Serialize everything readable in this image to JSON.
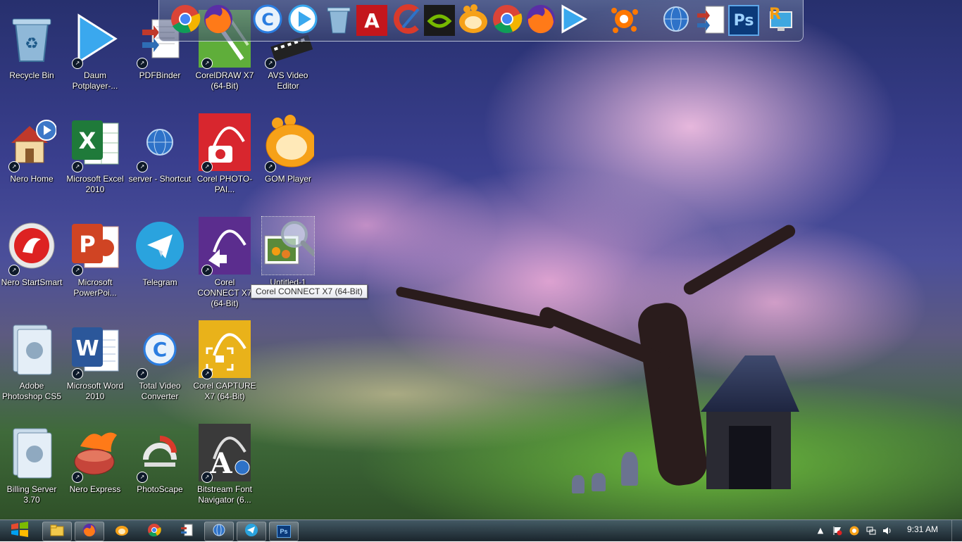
{
  "desktop": {
    "icons": [
      {
        "label": "Recycle Bin",
        "icon": "recycle-bin-icon"
      },
      {
        "label": "Daum Potplayer-...",
        "icon": "potplayer-icon"
      },
      {
        "label": "PDFBinder",
        "icon": "pdfbinder-icon"
      },
      {
        "label": "CorelDRAW X7 (64-Bit)",
        "icon": "coreldraw-icon"
      },
      {
        "label": "AVS Video Editor",
        "icon": "avs-video-editor-icon"
      },
      {
        "label": "Nero Home",
        "icon": "nero-home-icon"
      },
      {
        "label": "Microsoft Excel 2010",
        "icon": "excel-icon"
      },
      {
        "label": "server - Shortcut",
        "icon": "server-globe-icon"
      },
      {
        "label": "Corel PHOTO-PAI...",
        "icon": "corel-photo-paint-icon"
      },
      {
        "label": "GOM Player",
        "icon": "gom-player-icon"
      },
      {
        "label": "Nero StartSmart",
        "icon": "nero-startsmart-icon"
      },
      {
        "label": "Microsoft PowerPoi...",
        "icon": "powerpoint-icon"
      },
      {
        "label": "Telegram",
        "icon": "telegram-icon"
      },
      {
        "label": "Corel CONNECT X7 (64-Bit)",
        "icon": "corel-connect-icon"
      },
      {
        "label": "Untitled-1",
        "icon": "image-search-icon"
      },
      {
        "label": "Adobe Photoshop CS5",
        "icon": "photoshop-folder-icon"
      },
      {
        "label": "Microsoft Word 2010",
        "icon": "word-icon"
      },
      {
        "label": "Total Video Converter",
        "icon": "total-video-converter-icon"
      },
      {
        "label": "Corel CAPTURE X7 (64-Bit)",
        "icon": "corel-capture-icon"
      },
      {
        "label": "Billing Server 3.70",
        "icon": "billing-server-icon"
      },
      {
        "label": "Nero Express",
        "icon": "nero-express-icon"
      },
      {
        "label": "PhotoScape",
        "icon": "photoscape-icon"
      },
      {
        "label": "Bitstream Font Navigator (6...",
        "icon": "font-navigator-icon"
      }
    ],
    "tooltip": "Corel CONNECT X7 (64-Bit)"
  },
  "dock": {
    "items": [
      "chrome-icon",
      "firefox-icon",
      "cyberlink-icon",
      "potplayer-icon",
      "recycle-bin-icon",
      "acrobat-icon",
      "ccleaner-icon",
      "nvidia-icon",
      "gom-player-icon",
      "chrome-icon",
      "firefox-icon",
      "potplayer-icon",
      "avast-icon",
      "server-globe-icon",
      "pdfbinder-icon",
      "photoshop-icon",
      "remote-desktop-icon"
    ],
    "text": {
      "photoshop": "Ps",
      "acrobat": "A",
      "remote": "R"
    }
  },
  "taskbar": {
    "buttons": [
      "explorer-icon",
      "firefox-icon",
      "gom-player-icon",
      "chrome-icon",
      "pdfbinder-icon",
      "server-globe-icon",
      "telegram-icon",
      "photoshop-icon"
    ],
    "photoshop_label": "Ps",
    "clock": "9:31 AM"
  },
  "colors": {
    "chrome_red": "#db4437",
    "chrome_green": "#0f9d58",
    "chrome_yellow": "#f4b400",
    "chrome_blue": "#4285f4",
    "firefox_orange": "#ff7a18",
    "firefox_purple": "#5a2ea6",
    "excel_green": "#1f7a3a",
    "word_blue": "#2b579a",
    "ppt_orange": "#d04423",
    "corel_red": "#d8262e",
    "corel_purple": "#5b2d8e",
    "corel_gold": "#e9b21a",
    "telegram_blue": "#2aa3de",
    "photoshop_blue": "#0b3a7a"
  }
}
